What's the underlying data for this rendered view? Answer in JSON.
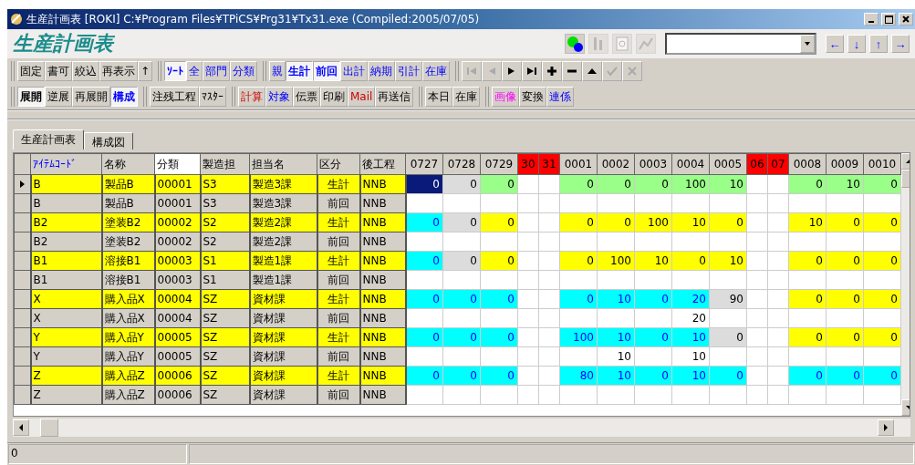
{
  "window": {
    "title": "生産計画表 [ROKI] C:¥Program Files¥TPiCS¥Prg31¥Tx31.exe (Compiled:2005/07/05)",
    "controls": [
      {
        "kind": "minimize"
      },
      {
        "kind": "maximize"
      },
      {
        "kind": "close"
      }
    ]
  },
  "header": {
    "title": "生産計画表",
    "tools": [
      {
        "kind": "status",
        "disabled": false
      },
      {
        "kind": "bars",
        "disabled": true
      },
      {
        "kind": "doc",
        "disabled": true
      },
      {
        "kind": "chart",
        "disabled": true
      }
    ],
    "arrows": [
      "←",
      "↓",
      "↑",
      "→"
    ]
  },
  "toolbar_1": [
    {
      "kind": "text",
      "items": [
        {
          "label": "固定",
          "kind": "plain",
          "pressed": false
        },
        {
          "label": "書可",
          "kind": "plain",
          "pressed": false
        },
        {
          "label": "絞込",
          "kind": "plain",
          "pressed": false
        },
        {
          "label": "再表示",
          "kind": "plain",
          "pressed": false
        },
        {
          "label": "↑",
          "kind": "plain",
          "pressed": false
        }
      ]
    },
    {
      "kind": "text",
      "items": [
        {
          "label": "ｿｰﾄ",
          "kind": "link",
          "pressed": true
        },
        {
          "label": "全",
          "kind": "link",
          "pressed": false
        },
        {
          "label": "部門",
          "kind": "link",
          "pressed": false
        },
        {
          "label": "分類",
          "kind": "link",
          "pressed": false
        }
      ]
    },
    {
      "kind": "text",
      "items": [
        {
          "label": "親",
          "kind": "link",
          "pressed": false
        },
        {
          "label": "生計",
          "kind": "link",
          "pressed": true
        },
        {
          "label": "前回",
          "kind": "link",
          "pressed": true
        },
        {
          "label": "出計",
          "kind": "link",
          "pressed": false
        },
        {
          "label": "納期",
          "kind": "link",
          "pressed": false
        },
        {
          "label": "引計",
          "kind": "link",
          "pressed": false
        },
        {
          "label": "在庫",
          "kind": "link",
          "pressed": false
        }
      ]
    },
    {
      "kind": "nav",
      "items": [
        {
          "kind": "first",
          "disabled": true
        },
        {
          "kind": "prev",
          "disabled": true
        },
        {
          "kind": "next",
          "disabled": false
        },
        {
          "kind": "last",
          "disabled": false
        },
        {
          "kind": "add",
          "disabled": false
        },
        {
          "kind": "remove",
          "disabled": false
        },
        {
          "kind": "up",
          "disabled": false
        },
        {
          "kind": "confirm",
          "disabled": true
        },
        {
          "kind": "cancel",
          "disabled": true
        }
      ]
    }
  ],
  "toolbar_2": [
    {
      "kind": "text",
      "items": [
        {
          "label": "展開",
          "kind": "plain",
          "pressed": true
        },
        {
          "label": "逆展",
          "kind": "plain",
          "pressed": false
        },
        {
          "label": "再展開",
          "kind": "plain",
          "pressed": false
        },
        {
          "label": "構成",
          "kind": "link",
          "pressed": true
        }
      ]
    },
    {
      "kind": "text",
      "items": [
        {
          "label": "注残工程",
          "kind": "plain",
          "pressed": false
        },
        {
          "label": "ﾏｽﾀｰ",
          "kind": "plain",
          "pressed": false
        }
      ]
    },
    {
      "kind": "text",
      "items": [
        {
          "label": "計算",
          "kind": "alert",
          "pressed": false
        },
        {
          "label": "対象",
          "kind": "link",
          "pressed": false
        },
        {
          "label": "伝票",
          "kind": "plain",
          "pressed": false
        },
        {
          "label": "印刷",
          "kind": "plain",
          "pressed": false
        },
        {
          "label": "Mail",
          "kind": "alert",
          "pressed": false
        },
        {
          "label": "再送信",
          "kind": "plain",
          "pressed": false
        }
      ]
    },
    {
      "kind": "text",
      "items": [
        {
          "label": "本日",
          "kind": "plain",
          "pressed": false
        },
        {
          "label": "在庫",
          "kind": "plain",
          "pressed": false
        }
      ]
    },
    {
      "kind": "text",
      "items": [
        {
          "label": "画像",
          "kind": "media",
          "pressed": false
        },
        {
          "label": "変換",
          "kind": "plain",
          "pressed": false
        },
        {
          "label": "連係",
          "kind": "link",
          "pressed": false
        }
      ]
    }
  ],
  "tabs": [
    {
      "label": "生産計画表",
      "selected": true
    },
    {
      "label": "構成図",
      "selected": false
    }
  ],
  "grid": {
    "columns": [
      {
        "label": "ｱｲﾃﾑｺｰﾄﾞ",
        "kind": "key",
        "selected": false
      },
      {
        "label": "名称",
        "kind": "plain",
        "selected": false
      },
      {
        "label": "分類",
        "kind": "plain",
        "selected": true
      },
      {
        "label": "製造担",
        "kind": "plain",
        "selected": false
      },
      {
        "label": "担当名",
        "kind": "plain",
        "selected": false
      },
      {
        "label": "区分",
        "kind": "plain",
        "selected": false
      },
      {
        "label": "後工程",
        "kind": "plain",
        "selected": false
      }
    ],
    "date_columns": [
      {
        "label": "0727",
        "holiday": false
      },
      {
        "label": "0728",
        "holiday": false
      },
      {
        "label": "0729",
        "holiday": false
      },
      {
        "label": "30",
        "holiday": true
      },
      {
        "label": "31",
        "holiday": true
      },
      {
        "label": "0001",
        "holiday": false
      },
      {
        "label": "0002",
        "holiday": false
      },
      {
        "label": "0003",
        "holiday": false
      },
      {
        "label": "0004",
        "holiday": false
      },
      {
        "label": "0005",
        "holiday": false
      },
      {
        "label": "06",
        "holiday": true
      },
      {
        "label": "07",
        "holiday": true
      },
      {
        "label": "0008",
        "holiday": false
      },
      {
        "label": "0009",
        "holiday": false
      },
      {
        "label": "0010",
        "holiday": false
      }
    ],
    "rows": [
      {
        "kind": "plan",
        "selected": true,
        "fields": [
          "B",
          "製品B",
          "00001",
          "S3",
          "製造3課",
          "生計",
          "NNB"
        ],
        "cells": [
          {
            "value": "0",
            "kind": "current"
          },
          {
            "value": "0",
            "kind": "grey"
          },
          {
            "value": "0",
            "kind": "green"
          },
          {
            "kind": "blank"
          },
          {
            "kind": "blank"
          },
          {
            "value": "0",
            "kind": "green"
          },
          {
            "value": "0",
            "kind": "green"
          },
          {
            "value": "0",
            "kind": "green"
          },
          {
            "value": "100",
            "kind": "green"
          },
          {
            "value": "10",
            "kind": "green"
          },
          {
            "kind": "blank"
          },
          {
            "kind": "blank"
          },
          {
            "value": "0",
            "kind": "green"
          },
          {
            "value": "10",
            "kind": "green"
          },
          {
            "value": "0",
            "kind": "green"
          }
        ]
      },
      {
        "kind": "previous",
        "selected": false,
        "fields": [
          "B",
          "製品B",
          "00001",
          "S3",
          "製造3課",
          "前回",
          "NNB"
        ],
        "cells": [
          {
            "kind": "blank"
          },
          {
            "kind": "blank"
          },
          {
            "kind": "blank"
          },
          {
            "kind": "blank"
          },
          {
            "kind": "blank"
          },
          {
            "kind": "blank"
          },
          {
            "kind": "blank"
          },
          {
            "kind": "blank"
          },
          {
            "kind": "blank"
          },
          {
            "kind": "blank"
          },
          {
            "kind": "blank"
          },
          {
            "kind": "blank"
          },
          {
            "kind": "blank"
          },
          {
            "kind": "blank"
          },
          {
            "kind": "blank"
          }
        ]
      },
      {
        "kind": "plan",
        "selected": false,
        "fields": [
          "B2",
          "塗装B2",
          "00002",
          "S2",
          "製造2課",
          "生計",
          "NNB"
        ],
        "cells": [
          {
            "value": "0",
            "kind": "cyan"
          },
          {
            "value": "0",
            "kind": "grey"
          },
          {
            "value": "0",
            "kind": "yellow"
          },
          {
            "kind": "blank"
          },
          {
            "kind": "blank"
          },
          {
            "value": "0",
            "kind": "yellow"
          },
          {
            "value": "0",
            "kind": "yellow"
          },
          {
            "value": "100",
            "kind": "yellow"
          },
          {
            "value": "10",
            "kind": "yellow"
          },
          {
            "value": "0",
            "kind": "yellow"
          },
          {
            "kind": "blank"
          },
          {
            "kind": "blank"
          },
          {
            "value": "10",
            "kind": "yellow"
          },
          {
            "value": "0",
            "kind": "yellow"
          },
          {
            "value": "0",
            "kind": "yellow"
          }
        ]
      },
      {
        "kind": "previous",
        "selected": false,
        "fields": [
          "B2",
          "塗装B2",
          "00002",
          "S2",
          "製造2課",
          "前回",
          "NNB"
        ],
        "cells": [
          {
            "kind": "blank"
          },
          {
            "kind": "blank"
          },
          {
            "kind": "blank"
          },
          {
            "kind": "blank"
          },
          {
            "kind": "blank"
          },
          {
            "kind": "blank"
          },
          {
            "kind": "blank"
          },
          {
            "kind": "blank"
          },
          {
            "kind": "blank"
          },
          {
            "kind": "blank"
          },
          {
            "kind": "blank"
          },
          {
            "kind": "blank"
          },
          {
            "kind": "blank"
          },
          {
            "kind": "blank"
          },
          {
            "kind": "blank"
          }
        ]
      },
      {
        "kind": "plan",
        "selected": false,
        "fields": [
          "B1",
          "溶接B1",
          "00003",
          "S1",
          "製造1課",
          "生計",
          "NNB"
        ],
        "cells": [
          {
            "value": "0",
            "kind": "cyan"
          },
          {
            "value": "0",
            "kind": "grey"
          },
          {
            "value": "0",
            "kind": "yellow"
          },
          {
            "kind": "blank"
          },
          {
            "kind": "blank"
          },
          {
            "value": "0",
            "kind": "yellow"
          },
          {
            "value": "100",
            "kind": "yellow"
          },
          {
            "value": "10",
            "kind": "yellow"
          },
          {
            "value": "0",
            "kind": "yellow"
          },
          {
            "value": "10",
            "kind": "yellow"
          },
          {
            "kind": "blank"
          },
          {
            "kind": "blank"
          },
          {
            "value": "0",
            "kind": "yellow"
          },
          {
            "value": "0",
            "kind": "yellow"
          },
          {
            "value": "0",
            "kind": "yellow"
          }
        ]
      },
      {
        "kind": "previous",
        "selected": false,
        "fields": [
          "B1",
          "溶接B1",
          "00003",
          "S1",
          "製造1課",
          "前回",
          "NNB"
        ],
        "cells": [
          {
            "kind": "blank"
          },
          {
            "kind": "blank"
          },
          {
            "kind": "blank"
          },
          {
            "kind": "blank"
          },
          {
            "kind": "blank"
          },
          {
            "kind": "blank"
          },
          {
            "kind": "blank"
          },
          {
            "kind": "blank"
          },
          {
            "kind": "blank"
          },
          {
            "kind": "blank"
          },
          {
            "kind": "blank"
          },
          {
            "kind": "blank"
          },
          {
            "kind": "blank"
          },
          {
            "kind": "blank"
          },
          {
            "kind": "blank"
          }
        ]
      },
      {
        "kind": "plan",
        "selected": false,
        "fields": [
          "X",
          "購入品X",
          "00004",
          "SZ",
          "資材課",
          "生計",
          "NNB"
        ],
        "cells": [
          {
            "value": "0",
            "kind": "cyan"
          },
          {
            "value": "0",
            "kind": "cyan"
          },
          {
            "value": "0",
            "kind": "cyan"
          },
          {
            "kind": "blank"
          },
          {
            "kind": "blank"
          },
          {
            "value": "0",
            "kind": "cyan"
          },
          {
            "value": "10",
            "kind": "cyan"
          },
          {
            "value": "0",
            "kind": "cyan"
          },
          {
            "value": "20",
            "kind": "cyan"
          },
          {
            "value": "90",
            "kind": "grey"
          },
          {
            "kind": "blank"
          },
          {
            "kind": "blank"
          },
          {
            "value": "0",
            "kind": "yellow"
          },
          {
            "value": "0",
            "kind": "yellow"
          },
          {
            "value": "0",
            "kind": "yellow"
          }
        ]
      },
      {
        "kind": "previous",
        "selected": false,
        "fields": [
          "X",
          "購入品X",
          "00004",
          "SZ",
          "資材課",
          "前回",
          "NNB"
        ],
        "cells": [
          {
            "kind": "blank"
          },
          {
            "kind": "blank"
          },
          {
            "kind": "blank"
          },
          {
            "kind": "blank"
          },
          {
            "kind": "blank"
          },
          {
            "kind": "blank"
          },
          {
            "kind": "blank"
          },
          {
            "kind": "blank"
          },
          {
            "value": "20",
            "kind": "plain"
          },
          {
            "kind": "blank"
          },
          {
            "kind": "blank"
          },
          {
            "kind": "blank"
          },
          {
            "kind": "blank"
          },
          {
            "kind": "blank"
          },
          {
            "kind": "blank"
          }
        ]
      },
      {
        "kind": "plan",
        "selected": false,
        "fields": [
          "Y",
          "購入品Y",
          "00005",
          "SZ",
          "資材課",
          "生計",
          "NNB"
        ],
        "cells": [
          {
            "value": "0",
            "kind": "cyan"
          },
          {
            "value": "0",
            "kind": "cyan"
          },
          {
            "value": "0",
            "kind": "cyan"
          },
          {
            "kind": "blank"
          },
          {
            "kind": "blank"
          },
          {
            "value": "100",
            "kind": "cyan"
          },
          {
            "value": "10",
            "kind": "cyan"
          },
          {
            "value": "0",
            "kind": "cyan"
          },
          {
            "value": "10",
            "kind": "cyan"
          },
          {
            "value": "0",
            "kind": "grey"
          },
          {
            "kind": "blank"
          },
          {
            "kind": "blank"
          },
          {
            "value": "0",
            "kind": "yellow"
          },
          {
            "value": "0",
            "kind": "yellow"
          },
          {
            "value": "0",
            "kind": "yellow"
          }
        ]
      },
      {
        "kind": "previous",
        "selected": false,
        "fields": [
          "Y",
          "購入品Y",
          "00005",
          "SZ",
          "資材課",
          "前回",
          "NNB"
        ],
        "cells": [
          {
            "kind": "blank"
          },
          {
            "kind": "blank"
          },
          {
            "kind": "blank"
          },
          {
            "kind": "blank"
          },
          {
            "kind": "blank"
          },
          {
            "kind": "blank"
          },
          {
            "value": "10",
            "kind": "plain"
          },
          {
            "kind": "blank"
          },
          {
            "value": "10",
            "kind": "plain"
          },
          {
            "kind": "blank"
          },
          {
            "kind": "blank"
          },
          {
            "kind": "blank"
          },
          {
            "kind": "blank"
          },
          {
            "kind": "blank"
          },
          {
            "kind": "blank"
          }
        ]
      },
      {
        "kind": "plan",
        "selected": false,
        "fields": [
          "Z",
          "購入品Z",
          "00006",
          "SZ",
          "資材課",
          "生計",
          "NNB"
        ],
        "cells": [
          {
            "value": "0",
            "kind": "cyan"
          },
          {
            "value": "0",
            "kind": "cyan"
          },
          {
            "value": "0",
            "kind": "cyan"
          },
          {
            "kind": "blank"
          },
          {
            "kind": "blank"
          },
          {
            "value": "80",
            "kind": "cyan"
          },
          {
            "value": "10",
            "kind": "cyan"
          },
          {
            "value": "0",
            "kind": "cyan"
          },
          {
            "value": "10",
            "kind": "cyan"
          },
          {
            "value": "0",
            "kind": "cyan"
          },
          {
            "kind": "blank"
          },
          {
            "kind": "blank"
          },
          {
            "value": "0",
            "kind": "cyan"
          },
          {
            "value": "0",
            "kind": "cyan"
          },
          {
            "value": "0",
            "kind": "cyan"
          }
        ]
      },
      {
        "kind": "previous",
        "selected": false,
        "fields": [
          "Z",
          "購入品Z",
          "00006",
          "SZ",
          "資材課",
          "前回",
          "NNB"
        ],
        "cells": [
          {
            "kind": "blank"
          },
          {
            "kind": "blank"
          },
          {
            "kind": "blank"
          },
          {
            "kind": "blank"
          },
          {
            "kind": "blank"
          },
          {
            "kind": "blank"
          },
          {
            "kind": "blank"
          },
          {
            "kind": "blank"
          },
          {
            "kind": "blank"
          },
          {
            "kind": "blank"
          },
          {
            "kind": "blank"
          },
          {
            "kind": "blank"
          },
          {
            "kind": "blank"
          },
          {
            "kind": "blank"
          },
          {
            "kind": "blank"
          }
        ]
      }
    ]
  },
  "status_bar": [
    "0"
  ]
}
